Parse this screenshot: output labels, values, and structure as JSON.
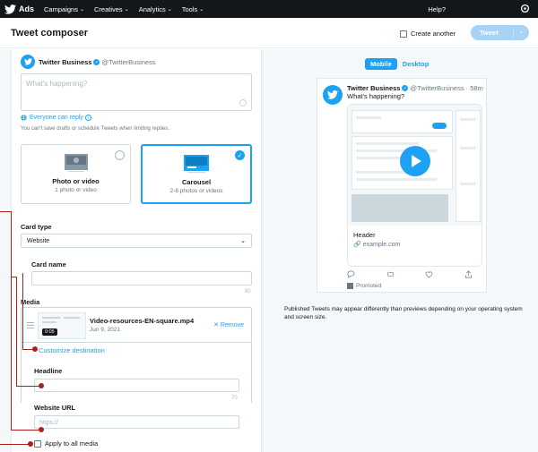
{
  "nav": {
    "brand": "Ads",
    "items": [
      "Campaigns",
      "Creatives",
      "Analytics",
      "Tools"
    ],
    "help": "Help?"
  },
  "header": {
    "title": "Tweet composer",
    "create_another": "Create another",
    "tweet_button": "Tweet"
  },
  "composer": {
    "account_name": "Twitter Business",
    "account_handle": "@TwitterBusiness",
    "placeholder": "What’s happening?",
    "reply_setting": "Everyone can reply",
    "note": "You can't save drafts or schedule Tweets when limiting replies."
  },
  "format_options": [
    {
      "title": "Photo or video",
      "subtitle": "1 photo or video",
      "selected": false
    },
    {
      "title": "Carousel",
      "subtitle": "2-6 photos or videos",
      "selected": true
    }
  ],
  "card": {
    "type_label": "Card type",
    "type_value": "Website",
    "name_label": "Card name",
    "name_counter": "80"
  },
  "media": {
    "label": "Media",
    "file_name": "Video-resources-EN-square.mp4",
    "date": "Jun 9, 2021",
    "duration": "0:05",
    "remove": "Remove",
    "customize": "Customize destination",
    "headline_label": "Headline",
    "headline_counter": "70",
    "url_label": "Website URL",
    "url_placeholder": "https://",
    "apply_all": "Apply to all media"
  },
  "preview": {
    "tabs": [
      "Mobile",
      "Desktop"
    ],
    "name": "Twitter Business",
    "handle": "@TwitterBusiness",
    "time": "· 58m",
    "text": "What’s happening?",
    "card_header": "Header",
    "card_domain": "example.com",
    "promoted": "Promoted",
    "disclaimer": "Published Tweets may appear differently than previews depending on your operating system and screen size."
  },
  "colors": {
    "accent": "#1da1f2",
    "nav_bg": "#14171a",
    "annotation": "#b01e1e"
  }
}
